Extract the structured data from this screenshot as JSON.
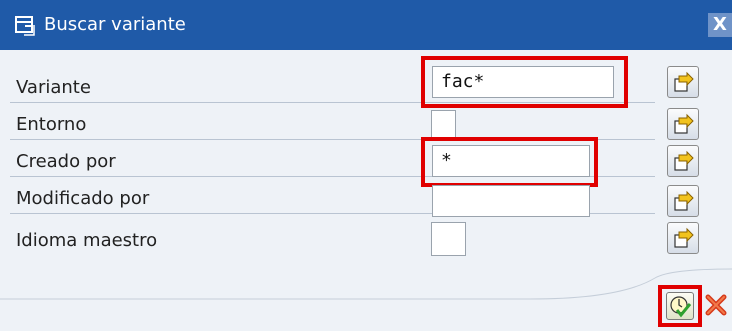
{
  "window": {
    "title": "Buscar variante",
    "close_symbol": "X"
  },
  "rows": [
    {
      "label": "Variante",
      "value": "fac*"
    },
    {
      "label": "Entorno",
      "value": ""
    },
    {
      "label": "Creado por",
      "value": "*"
    },
    {
      "label": "Modificado por",
      "value": ""
    },
    {
      "label": "Idioma maestro",
      "value": ""
    }
  ],
  "icons": {
    "title": "dialog-window-icon",
    "picker": "value-help-icon",
    "execute": "execute-check-icon",
    "cancel": "cancel-icon"
  },
  "colors": {
    "title_bar": "#1f5aa8",
    "highlight": "#e00000",
    "background": "#eef2f7"
  }
}
